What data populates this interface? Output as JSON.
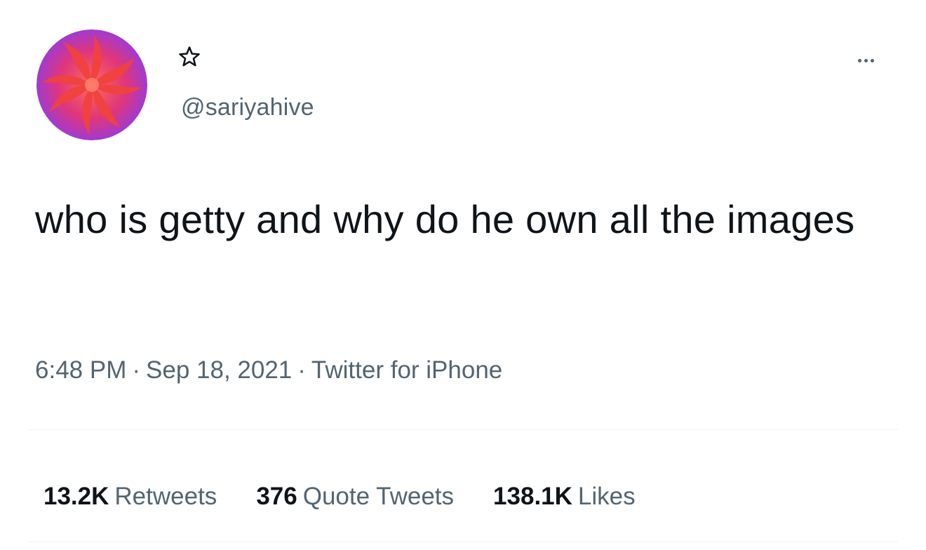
{
  "tweet": {
    "handle": "@sariyahive",
    "text": "who is getty and why do he own all the images",
    "time": "6:48 PM",
    "date": "Sep 18, 2021",
    "source": "Twitter for iPhone",
    "separator": "·"
  },
  "stats": {
    "retweets": {
      "count": "13.2K",
      "label": "Retweets"
    },
    "quote_tweets": {
      "count": "376",
      "label": "Quote Tweets"
    },
    "likes": {
      "count": "138.1K",
      "label": "Likes"
    }
  },
  "icons": {
    "avatar": "swirl-avatar",
    "name_badge": "star-icon",
    "more": "more-options-icon"
  },
  "colors": {
    "text_primary": "#0f1419",
    "text_secondary": "#536471",
    "avatar_red": "#f0433f",
    "avatar_purple": "#a63ad6",
    "avatar_pink": "#ff5f8a"
  }
}
